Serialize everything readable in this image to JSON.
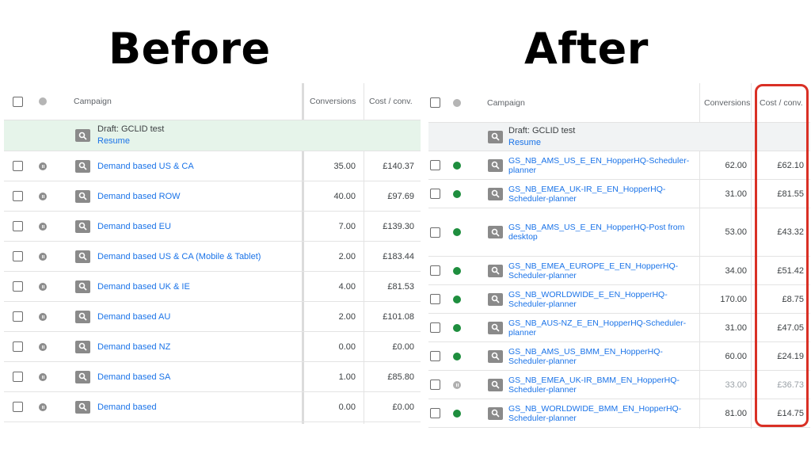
{
  "headings": {
    "before": "Before",
    "after": "After"
  },
  "before": {
    "columns": {
      "campaign": "Campaign",
      "conversions": "Conversions",
      "cost_conv": "Cost / conv."
    },
    "draft": {
      "title": "Draft: GCLID test",
      "action": "Resume"
    },
    "rows": [
      {
        "name": "Demand based US & CA",
        "conversions": "35.00",
        "cost": "£140.37",
        "status": "paused"
      },
      {
        "name": "Demand based ROW",
        "conversions": "40.00",
        "cost": "£97.69",
        "status": "paused"
      },
      {
        "name": "Demand based EU",
        "conversions": "7.00",
        "cost": "£139.30",
        "status": "paused"
      },
      {
        "name": "Demand based US & CA (Mobile & Tablet)",
        "conversions": "2.00",
        "cost": "£183.44",
        "status": "paused"
      },
      {
        "name": "Demand based UK & IE",
        "conversions": "4.00",
        "cost": "£81.53",
        "status": "paused"
      },
      {
        "name": "Demand based AU",
        "conversions": "2.00",
        "cost": "£101.08",
        "status": "paused"
      },
      {
        "name": "Demand based NZ",
        "conversions": "0.00",
        "cost": "£0.00",
        "status": "paused"
      },
      {
        "name": "Demand based SA",
        "conversions": "1.00",
        "cost": "£85.80",
        "status": "paused"
      },
      {
        "name": "Demand based",
        "conversions": "0.00",
        "cost": "£0.00",
        "status": "paused"
      }
    ]
  },
  "after": {
    "columns": {
      "campaign": "Campaign",
      "conversions": "Conversions",
      "cost_conv": "Cost / conv."
    },
    "draft": {
      "title": "Draft: GCLID test",
      "action": "Resume"
    },
    "rows": [
      {
        "line1": "GS_NB_AMS_US_E_EN_HopperHQ-Scheduler-",
        "line2": "planner",
        "conversions": "62.00",
        "cost": "£62.10",
        "status": "enabled"
      },
      {
        "line1": "GS_NB_EMEA_UK-IR_E_EN_HopperHQ-",
        "line2": "Scheduler-planner",
        "conversions": "31.00",
        "cost": "£81.55",
        "status": "enabled"
      },
      {
        "line1": "GS_NB_AMS_US_E_EN_HopperHQ-Post from",
        "line2": "desktop",
        "conversions": "53.00",
        "cost": "£43.32",
        "status": "enabled"
      },
      {
        "line1": "GS_NB_EMEA_EUROPE_E_EN_HopperHQ-",
        "line2": "Scheduler-planner",
        "conversions": "34.00",
        "cost": "£51.42",
        "status": "enabled"
      },
      {
        "line1": "GS_NB_WORLDWIDE_E_EN_HopperHQ-",
        "line2": "Scheduler-planner",
        "conversions": "170.00",
        "cost": "£8.75",
        "status": "enabled"
      },
      {
        "line1": "GS_NB_AUS-NZ_E_EN_HopperHQ-Scheduler-",
        "line2": "planner",
        "conversions": "31.00",
        "cost": "£47.05",
        "status": "enabled"
      },
      {
        "line1": "GS_NB_AMS_US_BMM_EN_HopperHQ-",
        "line2": "Scheduler-planner",
        "conversions": "60.00",
        "cost": "£24.19",
        "status": "enabled"
      },
      {
        "line1": "GS_NB_EMEA_UK-IR_BMM_EN_HopperHQ-",
        "line2": "Scheduler-planner",
        "conversions": "33.00",
        "cost": "£36.73",
        "status": "paused"
      },
      {
        "line1": "GS_NB_WORLDWIDE_BMM_EN_HopperHQ-",
        "line2": "Scheduler-planner",
        "conversions": "81.00",
        "cost": "£14.75",
        "status": "enabled"
      }
    ]
  },
  "colors": {
    "link": "#1a73e8",
    "enabled": "#1e8e3e",
    "paused": "#8c8c8c",
    "draft_bg": "#e6f4ea",
    "highlight": "#d93025"
  },
  "icons": {
    "row_icon": "search-icon",
    "status_icon": "status-dot-icon",
    "select": "checkbox-icon"
  }
}
